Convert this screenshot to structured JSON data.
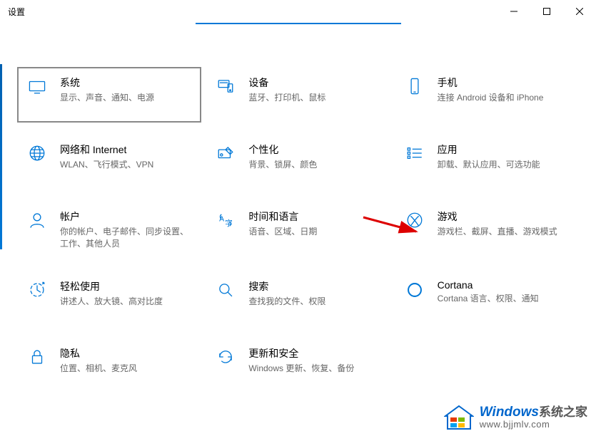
{
  "window": {
    "title": "设置"
  },
  "categories": [
    {
      "id": "system",
      "title": "系统",
      "subtitle": "显示、声音、通知、电源"
    },
    {
      "id": "devices",
      "title": "设备",
      "subtitle": "蓝牙、打印机、鼠标"
    },
    {
      "id": "phone",
      "title": "手机",
      "subtitle": "连接 Android 设备和 iPhone"
    },
    {
      "id": "network",
      "title": "网络和 Internet",
      "subtitle": "WLAN、飞行模式、VPN"
    },
    {
      "id": "personalize",
      "title": "个性化",
      "subtitle": "背景、锁屏、颜色"
    },
    {
      "id": "apps",
      "title": "应用",
      "subtitle": "卸载、默认应用、可选功能"
    },
    {
      "id": "accounts",
      "title": "帐户",
      "subtitle": "你的帐户、电子邮件、同步设置、工作、其他人员"
    },
    {
      "id": "timelang",
      "title": "时间和语言",
      "subtitle": "语音、区域、日期"
    },
    {
      "id": "gaming",
      "title": "游戏",
      "subtitle": "游戏栏、截屏、直播、游戏模式"
    },
    {
      "id": "ease",
      "title": "轻松使用",
      "subtitle": "讲述人、放大镜、高对比度"
    },
    {
      "id": "search",
      "title": "搜索",
      "subtitle": "查找我的文件、权限"
    },
    {
      "id": "cortana",
      "title": "Cortana",
      "subtitle": "Cortana 语言、权限、通知"
    },
    {
      "id": "privacy",
      "title": "隐私",
      "subtitle": "位置、相机、麦克风"
    },
    {
      "id": "update",
      "title": "更新和安全",
      "subtitle": "Windows 更新、恢复、备份"
    }
  ],
  "watermark": {
    "site": "Windows",
    "site_suffix": "系统之家",
    "url": "www.bjjmlv.com"
  }
}
